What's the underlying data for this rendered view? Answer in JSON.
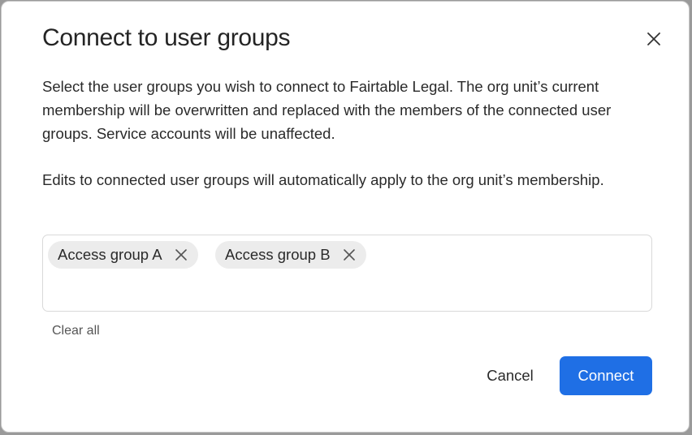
{
  "dialog": {
    "title": "Connect to user groups",
    "close_icon": "close-icon",
    "description_1": "Select the user groups you wish to connect to Fairtable Legal. The org unit’s current membership will be overwritten and replaced with the members of the connected user groups. Service accounts will be unaffected.",
    "description_2": "Edits to connected user groups will automatically apply to the org unit’s membership.",
    "selected_groups": [
      {
        "label": "Access group A",
        "remove_icon": "x-icon"
      },
      {
        "label": "Access group B",
        "remove_icon": "x-icon"
      }
    ],
    "clear_all_label": "Clear all",
    "cancel_label": "Cancel",
    "connect_label": "Connect"
  },
  "colors": {
    "primary": "#1f6fe5",
    "chip_background": "#ececec",
    "text": "#2a2a2a"
  }
}
